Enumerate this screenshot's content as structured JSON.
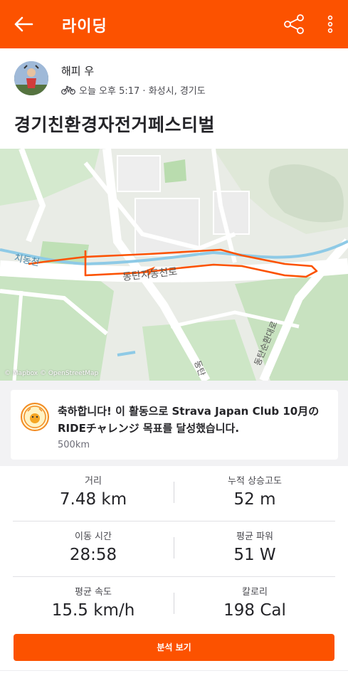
{
  "appbar": {
    "title": "라이딩"
  },
  "author": {
    "name": "해피 우",
    "meta": "오늘 오후 5:17 · 화성시, 경기도"
  },
  "activity": {
    "title": "경기친환경자전거페스티벌"
  },
  "map": {
    "attribution": "© Mapbox © OpenStreetMap",
    "labels": {
      "road_main": "동탄지동천로",
      "stream": "치동천",
      "road_vertical_1": "동탄",
      "road_vertical_2": "동탄순환대로"
    }
  },
  "achievement": {
    "message": "축하합니다! 이 활동으로 Strava Japan Club 10月のRIDEチャレンジ 목표를 달성했습니다.",
    "detail": "500km"
  },
  "stats": [
    {
      "left": {
        "label": "거리",
        "value": "7.48 km"
      },
      "right": {
        "label": "누적 상승고도",
        "value": "52 m"
      }
    },
    {
      "left": {
        "label": "이동 시간",
        "value": "28:58"
      },
      "right": {
        "label": "평균 파워",
        "value": "51 W"
      }
    },
    {
      "left": {
        "label": "평균 속도",
        "value": "15.5 km/h"
      },
      "right": {
        "label": "칼로리",
        "value": "198 Cal"
      }
    }
  ],
  "cta": {
    "label": "분석 보기"
  },
  "colors": {
    "brand": "#fc5200",
    "route": "#fc5200",
    "water": "#8ecae6",
    "park": "#c7e2c0"
  }
}
